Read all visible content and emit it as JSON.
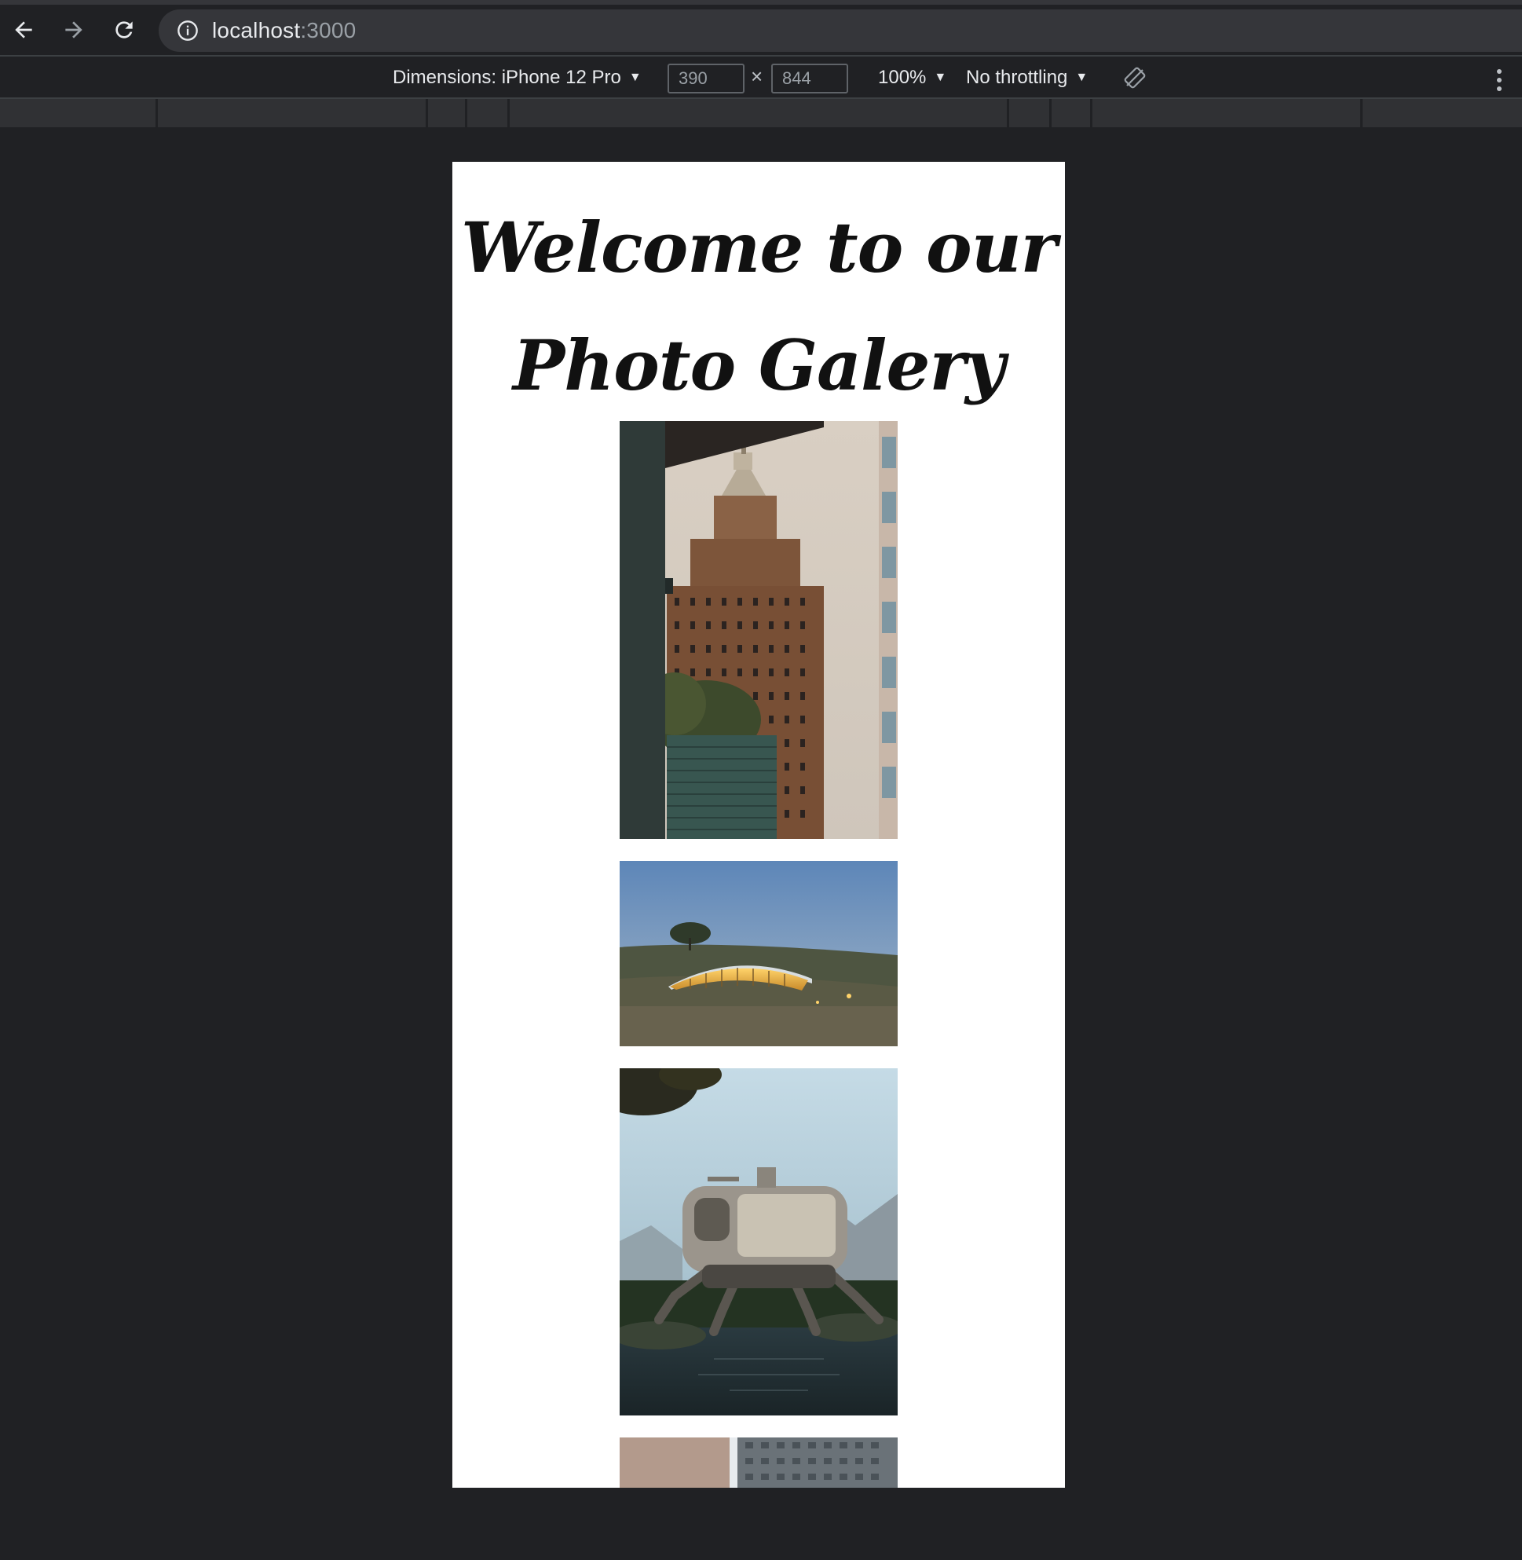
{
  "browser": {
    "url_host": "localhost",
    "url_port": ":3000"
  },
  "device_toolbar": {
    "dimensions_label": "Dimensions: iPhone 12 Pro",
    "width_value": "390",
    "height_value": "844",
    "times_symbol": "×",
    "zoom": "100%",
    "throttling": "No throttling"
  },
  "page": {
    "heading_line1": "Welcome to our",
    "heading_line2": "Photo Galery",
    "photos": [
      {
        "name": "art-deco-skyscraper-photo"
      },
      {
        "name": "hillside-house-at-dusk-photo"
      },
      {
        "name": "walking-robot-house-photo"
      },
      {
        "name": "city-buildings-photo"
      }
    ]
  }
}
